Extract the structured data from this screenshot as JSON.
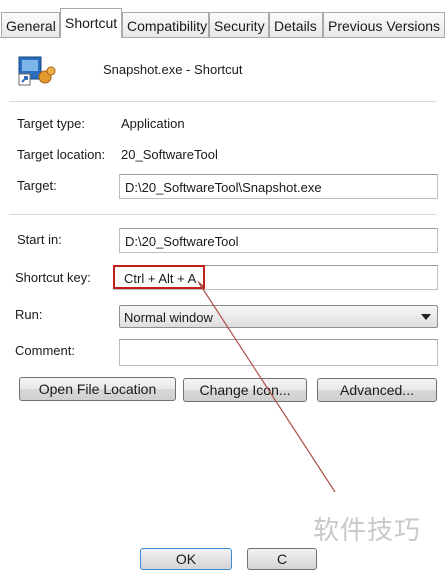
{
  "tabs": [
    {
      "label": "General"
    },
    {
      "label": "Shortcut"
    },
    {
      "label": "Compatibility"
    },
    {
      "label": "Security"
    },
    {
      "label": "Details"
    },
    {
      "label": "Previous Versions"
    }
  ],
  "header": {
    "title": "Snapshot.exe - Shortcut",
    "icon": "shortcut-app-icon"
  },
  "fields": {
    "target_type": {
      "label": "Target type:",
      "value": "Application"
    },
    "target_location": {
      "label": "Target location:",
      "value": "20_SoftwareTool"
    },
    "target": {
      "label": "Target:",
      "value": "D:\\20_SoftwareTool\\Snapshot.exe"
    },
    "start_in": {
      "label": "Start in:",
      "value": "D:\\20_SoftwareTool"
    },
    "shortcut_key": {
      "label": "Shortcut key:",
      "value": "Ctrl + Alt + A"
    },
    "run": {
      "label": "Run:",
      "value": "Normal window"
    },
    "comment": {
      "label": "Comment:",
      "value": ""
    }
  },
  "buttons": {
    "open_file_location": "Open File Location",
    "change_icon": "Change Icon...",
    "advanced": "Advanced..."
  },
  "bottom_buttons": {
    "ok": "OK",
    "cancel": "C"
  },
  "watermark": "软件技巧",
  "colors": {
    "highlight": "#c0201a",
    "arrow": "#b0504a"
  }
}
